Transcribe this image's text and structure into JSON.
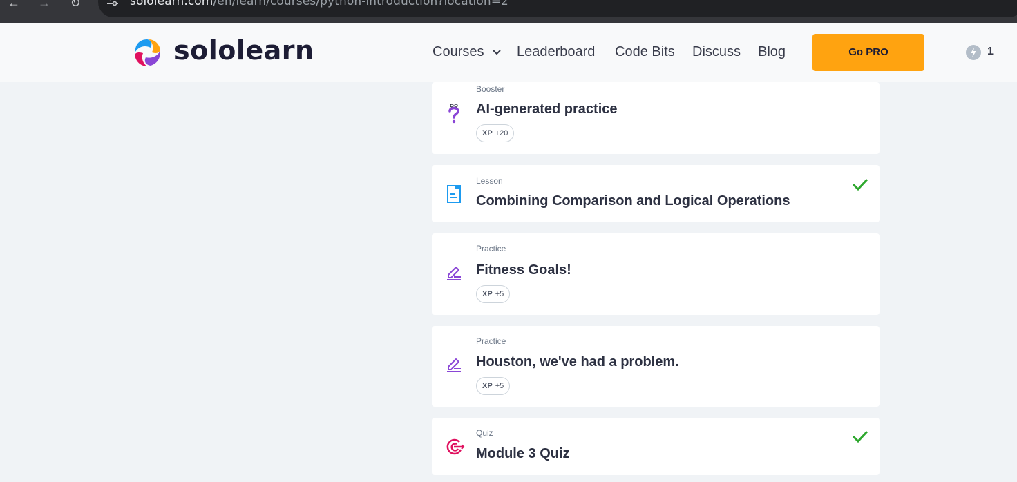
{
  "browser": {
    "url_host": "sololearn.com",
    "url_path": "/en/learn/courses/python-introduction?location=2",
    "back_icon": "arrow-left-icon",
    "forward_icon": "arrow-right-icon",
    "reload_icon": "reload-icon"
  },
  "header": {
    "brand": "sololearn",
    "nav": {
      "courses": "Courses",
      "leaderboard": "Leaderboard",
      "code_bits": "Code Bits",
      "discuss": "Discuss",
      "blog": "Blog"
    },
    "go_pro": "Go PRO",
    "streak_count": "1"
  },
  "colors": {
    "accent": "#ffa310",
    "check_green": "#2ea82e",
    "purple": "#8a46d6",
    "blue": "#1d9bf0",
    "pink": "#e0115f"
  },
  "items": [
    {
      "kind": "Booster",
      "title": "AI-generated practice",
      "xp_label": "XP",
      "xp_value": "+20",
      "icon": "question-icon",
      "completed": false
    },
    {
      "kind": "Lesson",
      "title": "Combining Comparison and Logical Operations",
      "icon": "lesson-icon",
      "completed": true
    },
    {
      "kind": "Practice",
      "title": "Fitness Goals!",
      "xp_label": "XP",
      "xp_value": "+5",
      "icon": "pencil-icon",
      "completed": false
    },
    {
      "kind": "Practice",
      "title": "Houston, we've had a problem.",
      "xp_label": "XP",
      "xp_value": "+5",
      "icon": "pencil-icon",
      "completed": false
    },
    {
      "kind": "Quiz",
      "title": "Module 3 Quiz",
      "icon": "target-icon",
      "completed": true
    }
  ]
}
